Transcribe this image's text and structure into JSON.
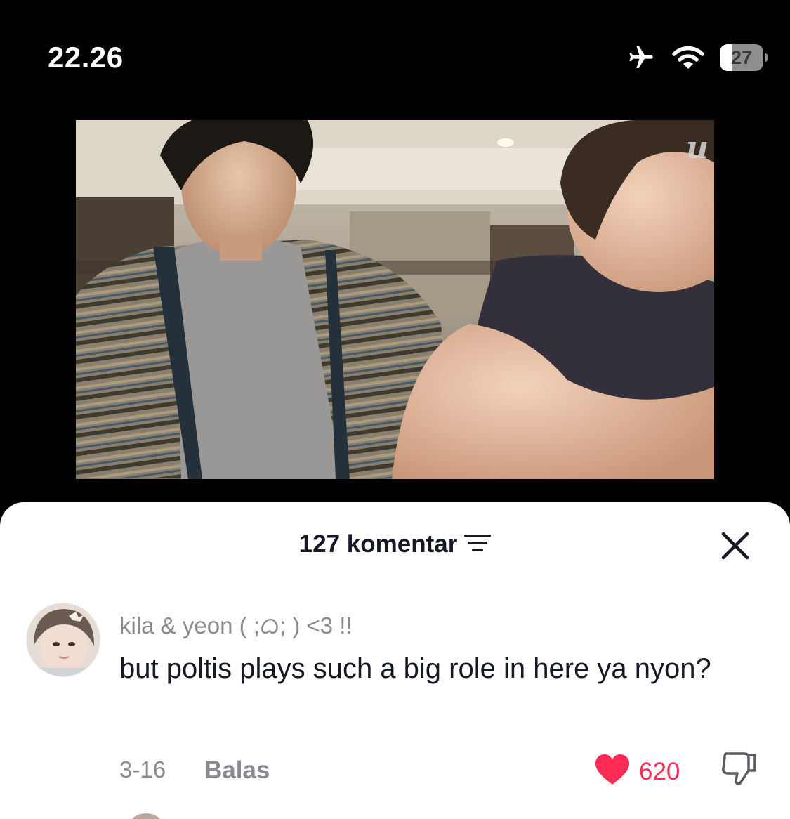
{
  "status_bar": {
    "time": "22.26",
    "icons": [
      "airplane-icon",
      "wifi-icon"
    ],
    "battery_level": "27",
    "battery_fraction": 0.27
  },
  "video": {
    "watermark": "u"
  },
  "comments_sheet": {
    "header": {
      "count_label": "127 komentar",
      "sort_icon": "filter-lines-icon",
      "close_icon": "close-icon"
    },
    "comment": {
      "username": "kila & yeon ( ;ᜊ; ) <3 !!",
      "text": "but poltis plays such a big role in here ya nyon?",
      "date": "3-16",
      "reply_label": "Balas",
      "like_count": "620",
      "liked": true
    }
  },
  "colors": {
    "like": "#fe2c55",
    "secondary_text": "#8a8b91",
    "primary_text": "#161823"
  }
}
